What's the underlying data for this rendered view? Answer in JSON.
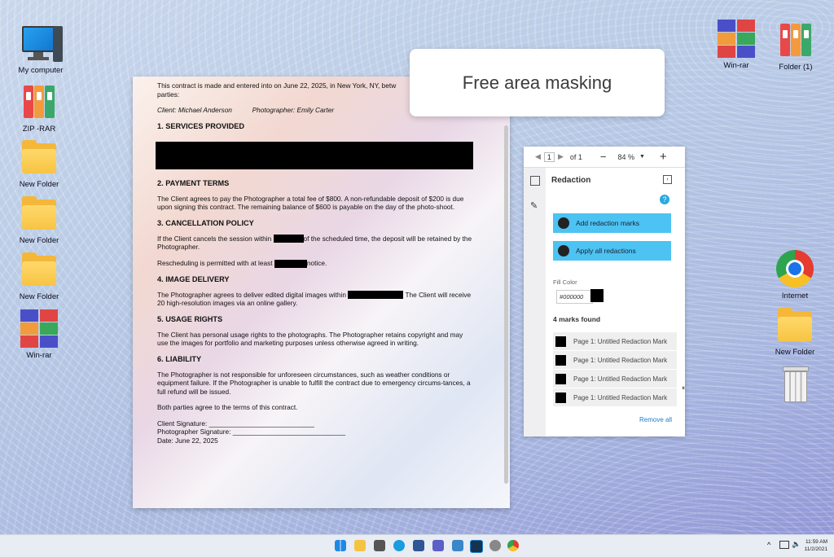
{
  "desktop": {
    "icons_left": [
      {
        "label": "My computer",
        "icon": "computer-icon"
      },
      {
        "label": "ZIP -RAR",
        "icon": "binders-icon"
      },
      {
        "label": "New Folder",
        "icon": "folder-icon"
      },
      {
        "label": "New Folder",
        "icon": "folder-icon"
      },
      {
        "label": "New Folder",
        "icon": "folder-icon"
      },
      {
        "label": "Win-rar",
        "icon": "winrar-icon"
      }
    ],
    "icons_right": [
      {
        "label": "Win-rar",
        "icon": "winrar-icon"
      },
      {
        "label": "Folder (1)",
        "icon": "binders-icon"
      },
      {
        "label": "Internet",
        "icon": "chrome-icon"
      },
      {
        "label": "New Folder",
        "icon": "folder-icon"
      },
      {
        "label": "",
        "icon": "recycle-bin-icon"
      }
    ]
  },
  "callout": {
    "text": "Free area masking"
  },
  "document": {
    "intro": "This contract is made and entered into on June 22, 2025, in New York, NY, betw",
    "intro2": "parties:",
    "client_line": "Client: Michael Anderson",
    "photographer_line": "Photographer: Emily Carter",
    "s1": "1. SERVICES PROVIDED",
    "s2": "2. PAYMENT TERMS",
    "s2_body": "The Client agrees to pay the Photographer a total fee of $800. A non-refundable deposit of $200 is due upon signing this contract. The remaining balance of $600 is payable on the day of the photo-shoot.",
    "s3": "3. CANCELLATION POLICY",
    "s3_a1": "If the Client cancels the session within",
    "s3_a2": "of the scheduled time, the deposit will be retained by the Photographer.",
    "s3_b1": "Rescheduling is permitted with at least",
    "s3_b2": "notice.",
    "s4": "4. IMAGE DELIVERY",
    "s4_a1": "The Photographer agrees to deliver edited digital images within",
    "s4_a2": "The Client will receive 20 high-resolution images via an online gallery.",
    "s5": "5. USAGE RIGHTS",
    "s5_body": "The Client has personal usage rights to the photographs. The Photographer retains copyright and may use the images for portfolio and marketing purposes unless otherwise agreed in writing.",
    "s6": "6. LIABILITY",
    "s6_body": "The Photographer is not responsible for unforeseen circumstances, such as weather conditions or equipment failure. If the Photographer is unable to fulfill the contract due to emergency circums-tances, a full refund will be issued.",
    "agree": "Both parties agree to the terms of this contract.",
    "client_sig": "Client Signature: ____________________________",
    "photo_sig": "Photographer Signature: ______________________________",
    "date": "Date: June 22, 2025"
  },
  "panel": {
    "page_current": "1",
    "page_total": "of 1",
    "zoom": "84 %",
    "title": "Redaction",
    "add_button": "Add redaction marks",
    "apply_button": "Apply all redactions",
    "fill_label": "Fill Color",
    "fill_value": "#000000",
    "fill_color": "#000000",
    "marks_found": "4 marks found",
    "marks": [
      "Page 1: Untitled Redaction Mark",
      "Page 1: Untitled Redaction Mark",
      "Page 1: Untitled Redaction Mark",
      "Page 1: Untitled Redaction Mark"
    ],
    "remove_all": "Remove all"
  },
  "taskbar": {
    "time": "11:59 AM",
    "date": "11/2/2021"
  }
}
